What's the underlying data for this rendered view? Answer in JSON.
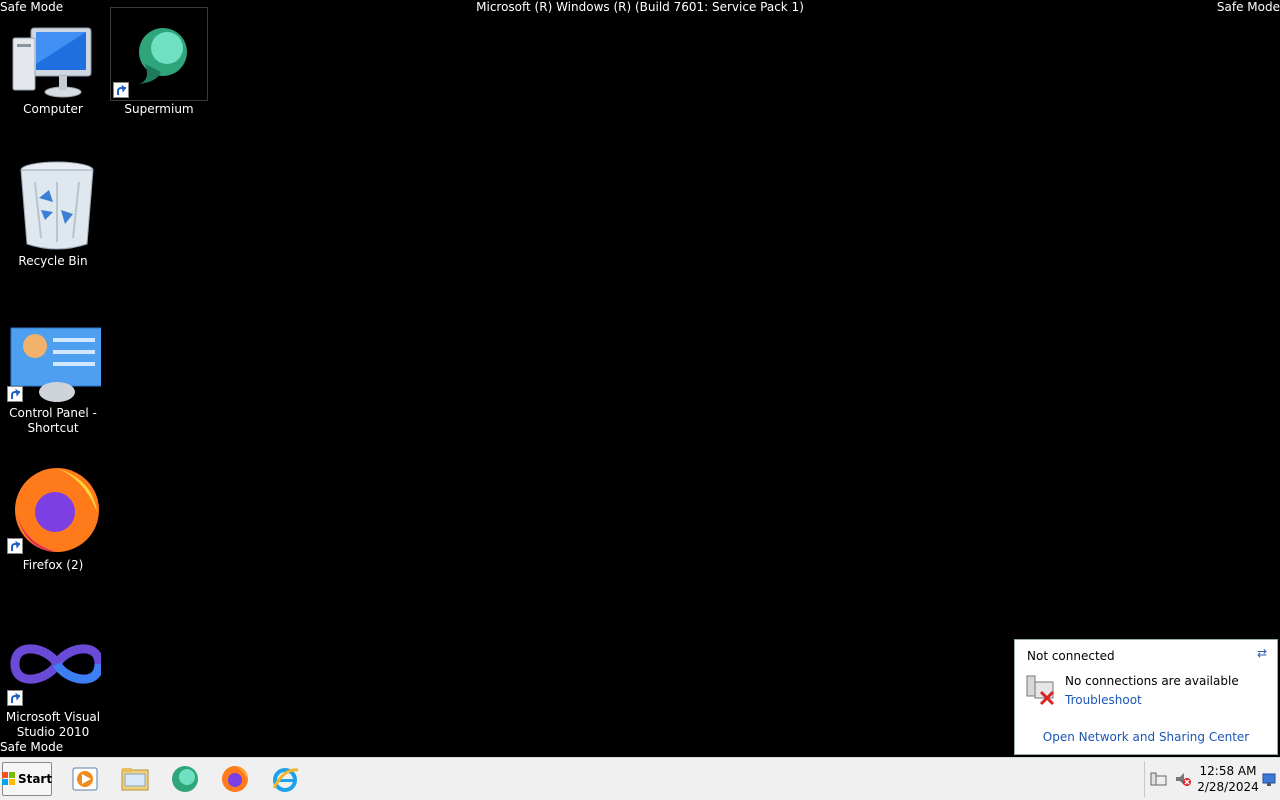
{
  "overlay": {
    "safe_mode_top_left": "Safe Mode",
    "safe_mode_top_right": "Safe Mode",
    "safe_mode_bottom_left": "Safe Mode",
    "build_text": "Microsoft (R) Windows (R) (Build 7601: Service Pack 1)"
  },
  "desktop": {
    "icons": [
      {
        "label": "Computer"
      },
      {
        "label": "Supermium"
      },
      {
        "label": "Recycle Bin"
      },
      {
        "label": "Control Panel - Shortcut"
      },
      {
        "label": "Firefox (2)"
      },
      {
        "label": "Microsoft Visual Studio 2010"
      }
    ]
  },
  "network_popup": {
    "title": "Not connected",
    "message": "No connections are available",
    "troubleshoot_link": "Troubleshoot",
    "open_center_link": "Open Network and Sharing Center"
  },
  "taskbar": {
    "start_label": "Start",
    "pinned": [
      "media-player",
      "explorer",
      "supermium",
      "firefox",
      "internet-explorer"
    ],
    "clock_time": "12:58 AM",
    "clock_date": "2/28/2024"
  }
}
